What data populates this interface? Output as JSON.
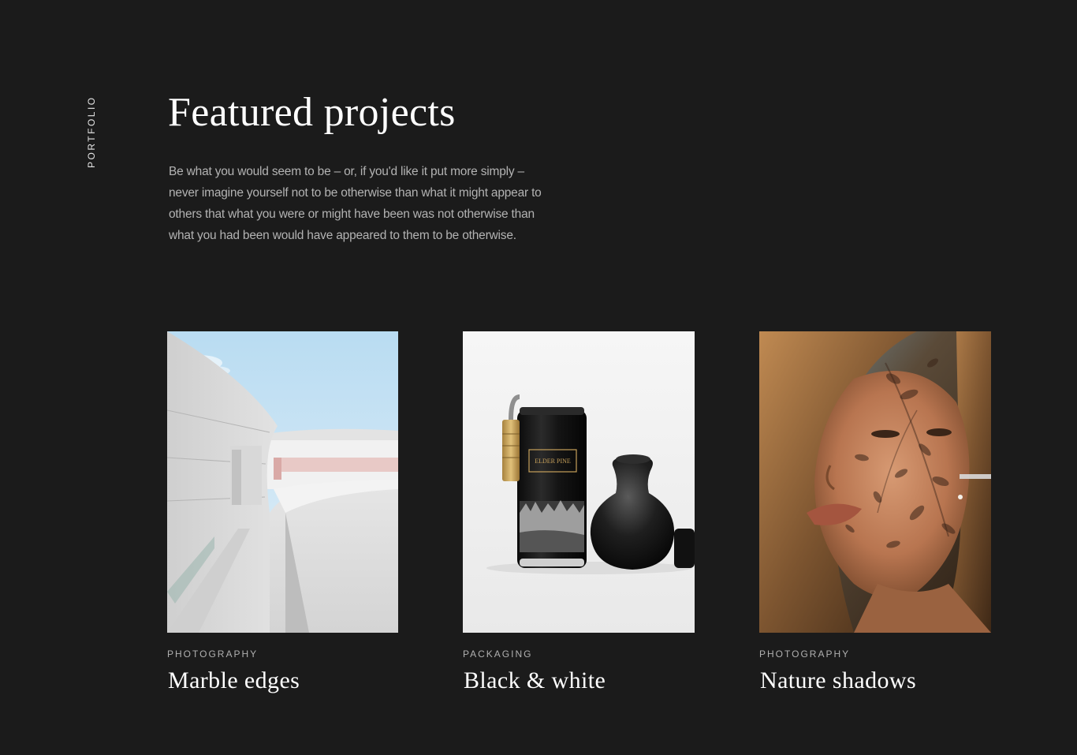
{
  "sidebar": {
    "label": "PORTFOLIO"
  },
  "header": {
    "title": "Featured projects",
    "intro": "Be what you would seem to be – or, if you'd like it put more simply – never imagine yourself not to be otherwise than what it might appear to others that what you were or might have been was not otherwise than what you had been would have appeared to them to be otherwise."
  },
  "projects": [
    {
      "category": "PHOTOGRAPHY",
      "title": "Marble edges",
      "image": "architecture-photo"
    },
    {
      "category": "PACKAGING",
      "title": "Black & white",
      "image": "can-and-vase-photo"
    },
    {
      "category": "PHOTOGRAPHY",
      "title": "Nature shadows",
      "image": "portrait-photo"
    }
  ],
  "colors": {
    "background": "#1b1b1b",
    "heading": "#ffffff",
    "body_text": "#b3b3b3",
    "category_text": "#b0b0b0"
  }
}
